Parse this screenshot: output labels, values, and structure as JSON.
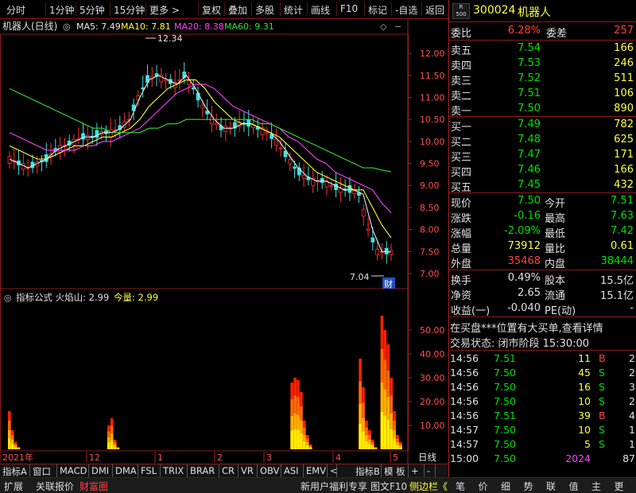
{
  "toolbar": {
    "items": [
      "分时",
      "1分钟",
      "5分钟",
      "15分钟",
      "更多 >",
      "复权",
      "叠加",
      "多股",
      "统计",
      "画线",
      "F10",
      "标记",
      "-自选",
      "返回"
    ]
  },
  "chart": {
    "title": "机器人(日线)",
    "ma_labels": [
      {
        "text": "MA5: 7.49",
        "color": "#e8e8e8"
      },
      {
        "text": "MA10: 7.81",
        "color": "#ffff30"
      },
      {
        "text": "MA20: 8.38",
        "color": "#ff40ff"
      },
      {
        "text": "MA60: 9.31",
        "color": "#30e030"
      }
    ],
    "high_marker": "12.34",
    "low_marker": "7.04",
    "event_badge": "财",
    "price_ticks": [
      "12.00",
      "11.50",
      "11.00",
      "10.50",
      "10.00",
      "9.50",
      "9.00",
      "8.50",
      "8.00",
      "7.50",
      "7.00"
    ],
    "indicator_title": "指标公式 火焰山: 2.99",
    "indicator_today": "今量: 2.99",
    "indicator_ticks": [
      "50.00",
      "40.00",
      "30.00",
      "20.00",
      "10.00"
    ],
    "date_labels": [
      "2021年",
      "12",
      "1",
      "2",
      "3",
      "4",
      "5"
    ],
    "period_label": "日线"
  },
  "chart_data": [
    {
      "type": "line",
      "title": "机器人(日线)",
      "ylim": [
        6.8,
        12.4
      ],
      "series": [
        {
          "name": "MA5",
          "color": "#e8e8e8",
          "values": [
            9.6,
            9.5,
            9.4,
            9.5,
            9.6,
            9.8,
            9.9,
            10.0,
            10.1,
            10.1,
            10.2,
            10.2,
            10.3,
            10.5,
            11.0,
            11.4,
            11.5,
            11.4,
            11.3,
            11.5,
            11.2,
            10.8,
            10.5,
            10.3,
            10.3,
            10.4,
            10.4,
            10.3,
            10.2,
            10.0,
            9.7,
            9.4,
            9.2,
            9.1,
            9.1,
            9.0,
            8.9,
            8.9,
            8.8,
            8.0,
            7.5,
            7.49
          ]
        },
        {
          "name": "MA10",
          "color": "#ffff30",
          "values": [
            9.9,
            9.8,
            9.7,
            9.6,
            9.6,
            9.7,
            9.8,
            9.9,
            9.9,
            10.0,
            10.1,
            10.1,
            10.2,
            10.3,
            10.5,
            10.8,
            11.0,
            11.2,
            11.3,
            11.4,
            11.4,
            11.2,
            10.9,
            10.7,
            10.5,
            10.4,
            10.4,
            10.3,
            10.2,
            10.1,
            9.9,
            9.7,
            9.5,
            9.3,
            9.2,
            9.1,
            9.0,
            8.9,
            8.9,
            8.5,
            8.1,
            7.81
          ]
        },
        {
          "name": "MA20",
          "color": "#ff40ff",
          "values": [
            10.2,
            10.1,
            10.0,
            9.9,
            9.8,
            9.8,
            9.8,
            9.8,
            9.9,
            9.9,
            10.0,
            10.0,
            10.1,
            10.2,
            10.3,
            10.5,
            10.7,
            10.9,
            11.1,
            11.2,
            11.3,
            11.3,
            11.2,
            11.0,
            10.8,
            10.7,
            10.6,
            10.5,
            10.4,
            10.3,
            10.1,
            10.0,
            9.8,
            9.6,
            9.5,
            9.3,
            9.2,
            9.1,
            9.0,
            8.9,
            8.6,
            8.38
          ]
        },
        {
          "name": "MA60",
          "color": "#30e030",
          "values": [
            11.2,
            11.1,
            11.0,
            10.9,
            10.8,
            10.7,
            10.6,
            10.5,
            10.4,
            10.3,
            10.3,
            10.2,
            10.2,
            10.2,
            10.2,
            10.3,
            10.3,
            10.4,
            10.4,
            10.5,
            10.5,
            10.5,
            10.5,
            10.5,
            10.5,
            10.5,
            10.5,
            10.4,
            10.4,
            10.3,
            10.2,
            10.1,
            10.0,
            9.9,
            9.8,
            9.7,
            9.6,
            9.5,
            9.4,
            9.4,
            9.35,
            9.31
          ]
        }
      ]
    },
    {
      "type": "bar",
      "title": "指标公式 火焰山",
      "ylim": [
        0,
        60
      ],
      "values": [
        16,
        8,
        3,
        1,
        0,
        0,
        0,
        0,
        0,
        0,
        0,
        0,
        0,
        0,
        0,
        0,
        0,
        0,
        0,
        0,
        0,
        0,
        0,
        0,
        0,
        0,
        0,
        0,
        0,
        0,
        0,
        0,
        10,
        13,
        4,
        1,
        0,
        0,
        0,
        0,
        0,
        0,
        0,
        0,
        0,
        0,
        0,
        0,
        0,
        0,
        0,
        0,
        0,
        0,
        0,
        0,
        0,
        0,
        0,
        0,
        0,
        0,
        0,
        0,
        0,
        0,
        0,
        0,
        0,
        0,
        0,
        0,
        0,
        0,
        0,
        0,
        0,
        0,
        0,
        0,
        0,
        0,
        0,
        0,
        0,
        0,
        0,
        0,
        0,
        0,
        0,
        28,
        30,
        29,
        24,
        12,
        6,
        2,
        0,
        0,
        0,
        0,
        0,
        0,
        0,
        0,
        0,
        0,
        0,
        0,
        0,
        0,
        0,
        38,
        26,
        12,
        8,
        4,
        1,
        0,
        56,
        50,
        44,
        30,
        16,
        6,
        2.99
      ]
    }
  ],
  "quote": {
    "logo_r": "R",
    "logo_500": "500",
    "code": "300024",
    "name": "机器人",
    "weibi_label": "委比",
    "weibi": "6.28%",
    "weicha_label": "委差",
    "weicha": "257",
    "asks": [
      {
        "label": "卖五",
        "price": "7.54",
        "vol": "166"
      },
      {
        "label": "卖四",
        "price": "7.53",
        "vol": "246"
      },
      {
        "label": "卖三",
        "price": "7.52",
        "vol": "511"
      },
      {
        "label": "卖二",
        "price": "7.51",
        "vol": "106"
      },
      {
        "label": "卖一",
        "price": "7.50",
        "vol": "890"
      }
    ],
    "bids": [
      {
        "label": "买一",
        "price": "7.49",
        "vol": "782"
      },
      {
        "label": "买二",
        "price": "7.48",
        "vol": "625"
      },
      {
        "label": "买三",
        "price": "7.47",
        "vol": "171"
      },
      {
        "label": "买四",
        "price": "7.46",
        "vol": "166"
      },
      {
        "label": "买五",
        "price": "7.45",
        "vol": "432"
      }
    ],
    "stats": [
      {
        "l1": "现价",
        "v1": "7.50",
        "c1": "#00e000",
        "l2": "今开",
        "v2": "7.51",
        "c2": "#00e000"
      },
      {
        "l1": "涨跌",
        "v1": "-0.16",
        "c1": "#00e000",
        "l2": "最高",
        "v2": "7.63",
        "c2": "#00e000"
      },
      {
        "l1": "涨幅",
        "v1": "-2.09%",
        "c1": "#00e000",
        "l2": "最低",
        "v2": "7.42",
        "c2": "#00e000"
      },
      {
        "l1": "总量",
        "v1": "73912",
        "c1": "#ffff40",
        "l2": "量比",
        "v2": "0.61",
        "c2": "#ffff40"
      },
      {
        "l1": "外盘",
        "v1": "35468",
        "c1": "#ff4040",
        "l2": "内盘",
        "v2": "38444",
        "c2": "#00e000"
      }
    ],
    "stats2": [
      {
        "l1": "换手",
        "v1": "0.49%",
        "l2": "股本",
        "v2": "15.5亿"
      },
      {
        "l1": "净资",
        "v1": "2.65",
        "l2": "流通",
        "v2": "15.1亿"
      },
      {
        "l1": "收益(一)",
        "v1": "-0.040",
        "l2": "PE(动)",
        "v2": "-"
      }
    ],
    "news": "在买盘***位置有大买单,查看详情",
    "status": "交易状态: 闭市阶段 15:30:00",
    "ticks": [
      {
        "t": "14:56",
        "p": "7.51",
        "v": "11",
        "f": "B",
        "n": "2"
      },
      {
        "t": "14:56",
        "p": "7.50",
        "v": "45",
        "f": "S",
        "n": "2"
      },
      {
        "t": "14:56",
        "p": "7.50",
        "v": "16",
        "f": "S",
        "n": "3"
      },
      {
        "t": "14:56",
        "p": "7.50",
        "v": "10",
        "f": "S",
        "n": "2"
      },
      {
        "t": "14:56",
        "p": "7.51",
        "v": "39",
        "f": "B",
        "n": "4"
      },
      {
        "t": "14:57",
        "p": "7.50",
        "v": "10",
        "f": "S",
        "n": "1"
      },
      {
        "t": "14:57",
        "p": "7.50",
        "v": "5",
        "f": "S",
        "n": "1"
      },
      {
        "t": "15:00",
        "p": "7.50",
        "v": "2024",
        "f": "",
        "n": "87"
      }
    ]
  },
  "tabs": [
    "指标A",
    "窗口",
    "MACD",
    "DMI",
    "DMA",
    "FSL",
    "TRIX",
    "BRAR",
    "CR",
    "VR",
    "OBV",
    "ASI",
    "EMV",
    "<",
    "指标B",
    "模 板",
    "+",
    "-"
  ],
  "bottom": {
    "left": [
      "扩展",
      "关联报价",
      "财富圈"
    ],
    "mid": [
      "新用户福利专享",
      "图文F10",
      "侧边栏《"
    ],
    "right": [
      "笔",
      "价",
      "细",
      "势",
      "联",
      "值",
      "主",
      "更"
    ]
  }
}
